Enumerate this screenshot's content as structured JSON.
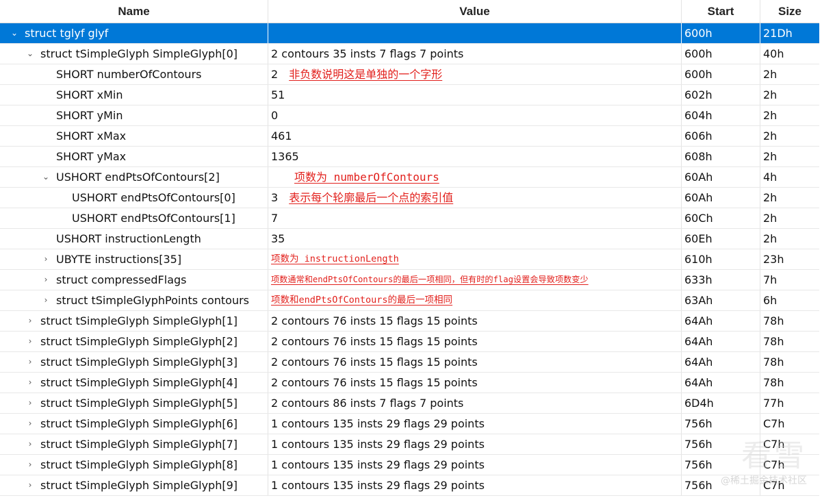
{
  "columns": {
    "name": "Name",
    "value": "Value",
    "start": "Start",
    "size": "Size"
  },
  "rows": [
    {
      "name": "struct tglyf glyf",
      "value": "",
      "start": "600h",
      "size": "21Dh"
    },
    {
      "name": "struct tSimpleGlyph SimpleGlyph[0]",
      "value": "2 contours 35 insts 7 flags 7 points",
      "start": "600h",
      "size": "40h"
    },
    {
      "name": "SHORT numberOfContours",
      "value": "2",
      "annotation": "非负数说明这是单独的一个字形",
      "start": "600h",
      "size": "2h"
    },
    {
      "name": "SHORT xMin",
      "value": "51",
      "start": "602h",
      "size": "2h"
    },
    {
      "name": "SHORT yMin",
      "value": "0",
      "start": "604h",
      "size": "2h"
    },
    {
      "name": "SHORT xMax",
      "value": "461",
      "start": "606h",
      "size": "2h"
    },
    {
      "name": "SHORT yMax",
      "value": "1365",
      "start": "608h",
      "size": "2h"
    },
    {
      "name": "USHORT endPtsOfContours[2]",
      "value": "",
      "annotation": "项数为 numberOfContours",
      "start": "60Ah",
      "size": "4h"
    },
    {
      "name": "USHORT endPtsOfContours[0]",
      "value": "3",
      "annotation": "表示每个轮廓最后一个点的索引值",
      "start": "60Ah",
      "size": "2h"
    },
    {
      "name": "USHORT endPtsOfContours[1]",
      "value": "7",
      "start": "60Ch",
      "size": "2h"
    },
    {
      "name": "USHORT instructionLength",
      "value": "35",
      "start": "60Eh",
      "size": "2h"
    },
    {
      "name": "UBYTE instructions[35]",
      "value": "",
      "annotation": "项数为 instructionLength",
      "start": "610h",
      "size": "23h"
    },
    {
      "name": "struct compressedFlags",
      "value": "",
      "annotation": "项数通常和endPtsOfContours的最后一项相同，但有时的flag设置会导致项数变少",
      "start": "633h",
      "size": "7h"
    },
    {
      "name": "struct tSimpleGlyphPoints contours",
      "value": "",
      "annotation": "项数和endPtsOfContours的最后一项相同",
      "start": "63Ah",
      "size": "6h"
    },
    {
      "name": "struct tSimpleGlyph SimpleGlyph[1]",
      "value": "2 contours 76 insts 15 flags 15 points",
      "start": "64Ah",
      "size": "78h"
    },
    {
      "name": "struct tSimpleGlyph SimpleGlyph[2]",
      "value": "2 contours 76 insts 15 flags 15 points",
      "start": "64Ah",
      "size": "78h"
    },
    {
      "name": "struct tSimpleGlyph SimpleGlyph[3]",
      "value": "2 contours 76 insts 15 flags 15 points",
      "start": "64Ah",
      "size": "78h"
    },
    {
      "name": "struct tSimpleGlyph SimpleGlyph[4]",
      "value": "2 contours 76 insts 15 flags 15 points",
      "start": "64Ah",
      "size": "78h"
    },
    {
      "name": "struct tSimpleGlyph SimpleGlyph[5]",
      "value": "2 contours 86 insts 7 flags 7 points",
      "start": "6D4h",
      "size": "77h"
    },
    {
      "name": "struct tSimpleGlyph SimpleGlyph[6]",
      "value": "1 contours 135 insts 29 flags 29 points",
      "start": "756h",
      "size": "C7h"
    },
    {
      "name": "struct tSimpleGlyph SimpleGlyph[7]",
      "value": "1 contours 135 insts 29 flags 29 points",
      "start": "756h",
      "size": "C7h"
    },
    {
      "name": "struct tSimpleGlyph SimpleGlyph[8]",
      "value": "1 contours 135 insts 29 flags 29 points",
      "start": "756h",
      "size": "C7h"
    },
    {
      "name": "struct tSimpleGlyph SimpleGlyph[9]",
      "value": "1 contours 135 insts 29 flags 29 points",
      "start": "756h",
      "size": "C7h"
    }
  ],
  "watermark": {
    "logo": "看雪",
    "text": "@稀土掘金技术社区"
  },
  "colors": {
    "selection": "#0078d7",
    "annotation": "#e2201c"
  }
}
